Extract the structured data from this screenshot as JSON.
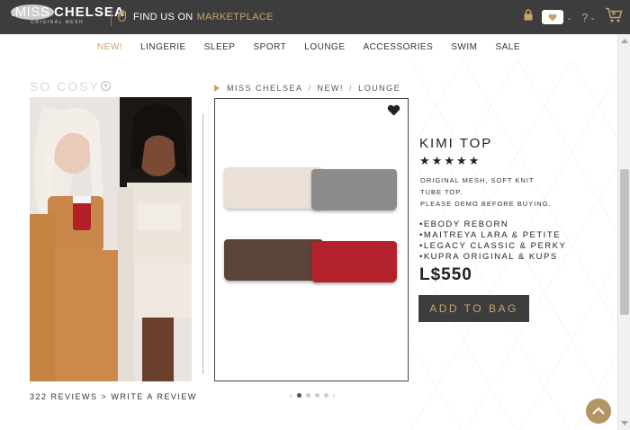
{
  "header": {
    "brand_prefix": ".MISS ",
    "brand_name": "CHELSEA",
    "brand_tagline": "ORIGINAL MESH",
    "find_us": "FIND US ON",
    "marketplace": "MARKETPLACE",
    "icons": [
      "lock-icon",
      "heart-icon",
      "help-icon",
      "cart-icon"
    ]
  },
  "nav": {
    "items": [
      {
        "label": "NEW!",
        "active": true
      },
      {
        "label": "LINGERIE"
      },
      {
        "label": "SLEEP"
      },
      {
        "label": "SPORT"
      },
      {
        "label": "LOUNGE"
      },
      {
        "label": "ACCESSORIES"
      },
      {
        "label": "SWIM"
      },
      {
        "label": "SALE"
      }
    ]
  },
  "promo": {
    "title": "SO COSY",
    "reviews_count": "322 REVIEWS",
    "reviews_sep": ">",
    "write_review": "WRITE A REVIEW"
  },
  "breadcrumb": {
    "items": [
      "MISS CHELSEA",
      "NEW!",
      "LOUNGE"
    ],
    "sep": "/"
  },
  "product": {
    "title": "KIMI TOP",
    "stars": "★★★★★",
    "rating": 5,
    "description_lines": [
      "ORIGINAL MESH, SOFT KNIT",
      "TUBE TOP.",
      "PLEASE DEMO BEFORE BUYING."
    ],
    "bodies": [
      "•EBODY REBORN",
      "•MAITREYA LARA & PETITE",
      "•LEGACY CLASSIC & PERKY",
      "•KUPRA ORIGINAL & KUPS"
    ],
    "price": "L$550",
    "add_to_bag": "ADD TO BAG",
    "colors": [
      "#eae0d6",
      "#8c8c8c",
      "#5a4538",
      "#b3222b"
    ]
  },
  "carousel": {
    "prev": "‹",
    "next": "›",
    "total": 5,
    "active": 1
  },
  "colors": {
    "topbar": "#3d3d3d",
    "gold": "#c9a46a",
    "active_nav": "#c9a46a"
  }
}
